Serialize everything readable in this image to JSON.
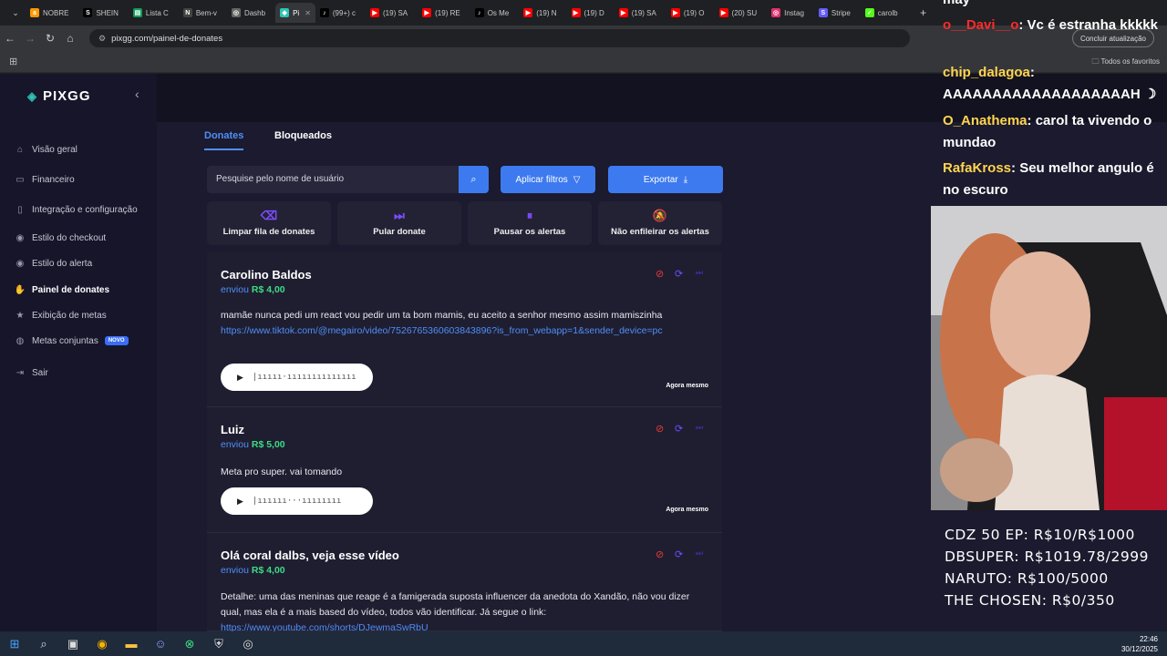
{
  "browser": {
    "tabs": [
      {
        "label": "NOBRE",
        "fav": "a",
        "color": "#ff9900"
      },
      {
        "label": "SHEIN",
        "fav": "S",
        "color": "#000000"
      },
      {
        "label": "Lista C",
        "fav": "▤",
        "color": "#0f9d58"
      },
      {
        "label": "Bem-v",
        "fav": "N",
        "color": "#444444"
      },
      {
        "label": "Dashb",
        "fav": "◎",
        "color": "#666666"
      },
      {
        "label": "Pi",
        "fav": "◆",
        "color": "#2ec4b6"
      },
      {
        "label": "(99+) c",
        "fav": "♪",
        "color": "#000000"
      },
      {
        "label": "(19) SA",
        "fav": "▶",
        "color": "#ff0000"
      },
      {
        "label": "(19) RE",
        "fav": "▶",
        "color": "#ff0000"
      },
      {
        "label": "Os Me",
        "fav": "♪",
        "color": "#000000"
      },
      {
        "label": "(19) N",
        "fav": "▶",
        "color": "#ff0000"
      },
      {
        "label": "(19) D",
        "fav": "▶",
        "color": "#ff0000"
      },
      {
        "label": "(19) SA",
        "fav": "▶",
        "color": "#ff0000"
      },
      {
        "label": "(19) O",
        "fav": "▶",
        "color": "#ff0000"
      },
      {
        "label": "(20) SU",
        "fav": "▶",
        "color": "#ff0000"
      },
      {
        "label": "Instag",
        "fav": "◎",
        "color": "#e1306c"
      },
      {
        "label": "Stripe",
        "fav": "S",
        "color": "#635bff"
      },
      {
        "label": "carolb",
        "fav": "✓",
        "color": "#53fc18"
      }
    ],
    "url": "pixgg.com/painel-de-donates",
    "update_label": "Concluir atualização",
    "all_bookmarks": "Todos os favoritos"
  },
  "sidebar": {
    "logo": "PIXGG",
    "items": [
      {
        "label": "Visão geral",
        "icon": "home-icon",
        "glyph": "⌂"
      },
      {
        "label": "Financeiro",
        "icon": "wallet-icon",
        "glyph": "▭"
      },
      {
        "label": "Integração e configuração",
        "icon": "document-icon",
        "glyph": "▯"
      },
      {
        "label": "Estilo do checkout",
        "icon": "palette-icon",
        "glyph": "◉"
      },
      {
        "label": "Estilo do alerta",
        "icon": "palette-icon",
        "glyph": "◉"
      },
      {
        "label": "Painel de donates",
        "icon": "hand-coin-icon",
        "glyph": "✋"
      },
      {
        "label": "Exibição de metas",
        "icon": "star-icon",
        "glyph": "★"
      },
      {
        "label": "Metas conjuntas",
        "icon": "globe-icon",
        "glyph": "◍",
        "badge": "NOVO"
      },
      {
        "label": "Sair",
        "icon": "logout-icon",
        "glyph": "⇥"
      }
    ]
  },
  "panel": {
    "tabs": [
      "Donates",
      "Bloqueados"
    ],
    "search_placeholder": "Pesquise pelo nome de usuário",
    "filter_label": "Aplicar filtros",
    "export_label": "Exportar",
    "actions": [
      {
        "label": "Limpar fila de donates",
        "icon": "eraser-icon",
        "glyph": "⌫"
      },
      {
        "label": "Pular donate",
        "icon": "skip-icon",
        "glyph": "⏭"
      },
      {
        "label": "Pausar os alertas",
        "icon": "pause-icon",
        "glyph": "⏸"
      },
      {
        "label": "Não enfileirar os alertas",
        "icon": "bell-off-icon",
        "glyph": "🔕"
      }
    ],
    "donations": [
      {
        "name": "Carolino Baldos",
        "sent_prefix": "enviou",
        "amount": "R$ 4,00",
        "message": "mamãe nunca pedi um react vou pedir um ta bom mamis, eu aceito a senhor mesmo assim mamiszinha",
        "link": "https://www.tiktok.com/@megairo/video/7526765360603843896?is_from_webapp=1&sender_device=pc",
        "time": "Agora mesmo"
      },
      {
        "name": "Luiz",
        "sent_prefix": "enviou",
        "amount": "R$ 5,00",
        "message": "Meta pro super. vai tomando",
        "link": "",
        "time": "Agora mesmo"
      },
      {
        "name": "Olá coral dalbs, veja esse vídeo",
        "sent_prefix": "enviou",
        "amount": "R$ 4,00",
        "message": "Detalhe: uma das meninas que reage é a famigerada suposta influencer da anedota do Xandão, não vou dizer qual, mas ela é a mais based do vídeo, todos vão identificar. Já segue o link:",
        "link": "https://www.youtube.com/shorts/DJewmaSwRbU",
        "time": ""
      }
    ]
  },
  "overlay": {
    "chat": [
      {
        "user": "may",
        "text": "",
        "color": "#ffffff"
      },
      {
        "user": "o__Davi__o",
        "text": ": Vc é estranha kkkkk",
        "color": "#ff2a2a"
      },
      {
        "user": "chip_dalagoa",
        "text": ": AAAAAAAAAAAAAAAAAAAH ☽",
        "color": "#ffd54f"
      },
      {
        "user": "O_Anathema",
        "text": ": carol ta vivendo o mundao",
        "color": "#ffd54f"
      },
      {
        "user": "RafaKross",
        "text": ": Seu melhor angulo é no escuro",
        "color": "#ffd54f"
      }
    ],
    "goals": [
      "CDZ 50 EP: R$10/R$1000",
      "DBSUPER: R$1019.78/2999",
      "NARUTO: R$100/5000",
      "THE CHOSEN: R$0/350"
    ]
  },
  "taskbar": {
    "time": "22:46",
    "date": "30/12/2025"
  }
}
